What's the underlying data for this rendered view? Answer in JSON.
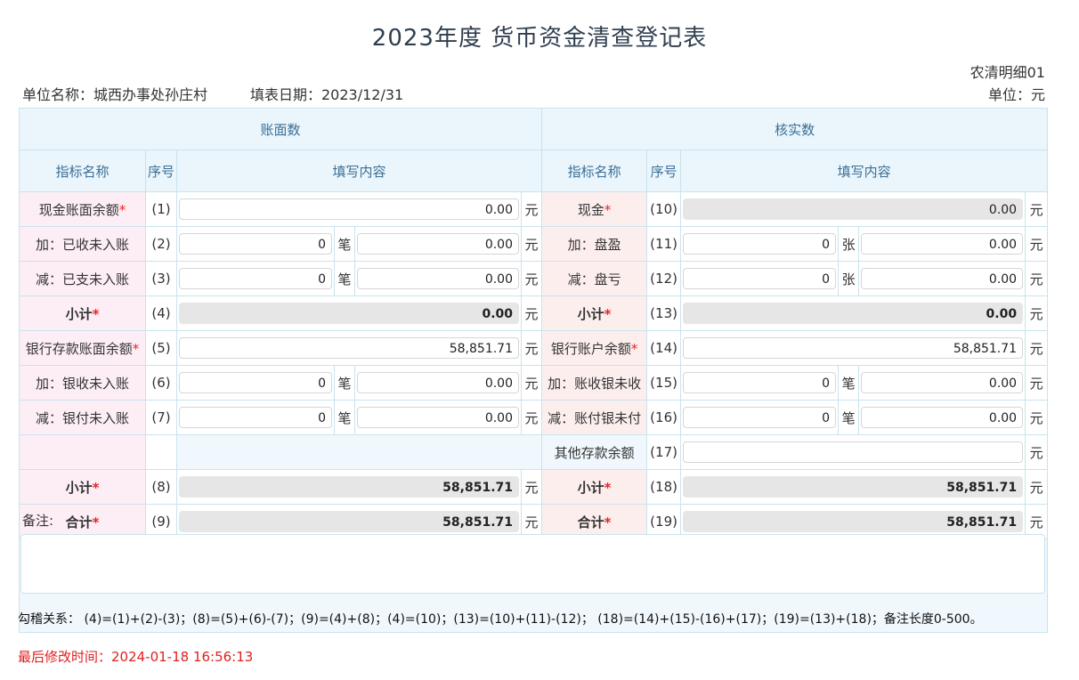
{
  "header": {
    "title": "2023年度 货币资金清查登记表",
    "form_code": "农清明细01",
    "unit_name": "单位名称：城西办事处孙庄村",
    "fill_date": "填表日期：2023/12/31",
    "unit": "单位：元"
  },
  "table": {
    "book_header": "账面数",
    "verify_header": "核实数",
    "col_indicator": "指标名称",
    "col_seq": "序号",
    "col_content": "填写内容",
    "unit_yuan": "元",
    "unit_bi": "笔",
    "unit_zhang": "张",
    "req_mark": "*",
    "rows": [
      {
        "l_label": "现金账面余额",
        "l_seq": "(1)",
        "l_amount": "0.00",
        "r_label": "现金",
        "r_seq": "(10)",
        "r_amount": "0.00"
      },
      {
        "l_label": "加：已收未入账",
        "l_seq": "(2)",
        "l_count": "0",
        "l_amount": "0.00",
        "r_label": "加：盘盈",
        "r_seq": "(11)",
        "r_count": "0",
        "r_amount": "0.00"
      },
      {
        "l_label": "减：已支未入账",
        "l_seq": "(3)",
        "l_count": "0",
        "l_amount": "0.00",
        "r_label": "减：盘亏",
        "r_seq": "(12)",
        "r_count": "0",
        "r_amount": "0.00"
      },
      {
        "l_label": "小计",
        "l_seq": "(4)",
        "l_amount": "0.00",
        "r_label": "小计",
        "r_seq": "(13)",
        "r_amount": "0.00"
      },
      {
        "l_label": "银行存款账面余额",
        "l_seq": "(5)",
        "l_amount": "58,851.71",
        "r_label": "银行账户余额",
        "r_seq": "(14)",
        "r_amount": "58,851.71"
      },
      {
        "l_label": "加：银收未入账",
        "l_seq": "(6)",
        "l_count": "0",
        "l_amount": "0.00",
        "r_label": "加：账收银未收",
        "r_seq": "(15)",
        "r_count": "0",
        "r_amount": "0.00"
      },
      {
        "l_label": "减：银付未入账",
        "l_seq": "(7)",
        "l_count": "0",
        "l_amount": "0.00",
        "r_label": "减：账付银未付",
        "r_seq": "(16)",
        "r_count": "0",
        "r_amount": "0.00"
      },
      {
        "r_label": "其他存款余额",
        "r_seq": "(17)",
        "r_amount": ""
      },
      {
        "l_label": "小计",
        "l_seq": "(8)",
        "l_amount": "58,851.71",
        "r_label": "小计",
        "r_seq": "(18)",
        "r_amount": "58,851.71"
      },
      {
        "l_label": "合计",
        "l_seq": "(9)",
        "l_amount": "58,851.71",
        "r_label": "合计",
        "r_seq": "(19)",
        "r_amount": "58,851.71"
      }
    ]
  },
  "note": {
    "label": "备注:",
    "value": ""
  },
  "footer": {
    "relation": "勾稽关系： (4)=(1)+(2)-(3)；(8)=(5)+(6)-(7)；(9)=(4)+(8)；(4)=(10)；(13)=(10)+(11)-(12)； (18)=(14)+(15)-(16)+(17)；(19)=(13)+(18)；备注长度0-500。",
    "last_modified": "最后修改时间：2024-01-18 16:56:13"
  }
}
